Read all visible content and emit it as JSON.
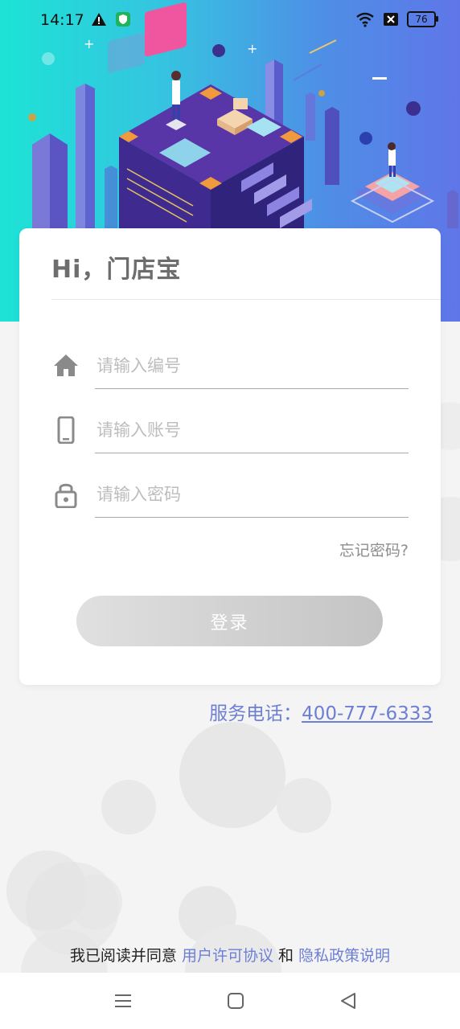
{
  "status": {
    "time": "14:17",
    "battery": "76",
    "icons": [
      "warning-icon",
      "shield-icon",
      "wifi-icon",
      "sim-off-icon",
      "battery-icon"
    ]
  },
  "login": {
    "title": "Hi，门店宝",
    "store_placeholder": "请输入编号",
    "account_placeholder": "请输入账号",
    "password_placeholder": "请输入密码",
    "forgot": "忘记密码?",
    "submit": "登录"
  },
  "service": {
    "label": "服务电话：",
    "phone": "400-777-6333"
  },
  "agreement": {
    "prefix": "我已阅读并同意",
    "user_agreement": "用户许可协议",
    "and": "和",
    "privacy": "隐私政策说明"
  },
  "colors": {
    "hero_start": "#1de3d5",
    "hero_end": "#5f76e8",
    "link": "#6d7fd4",
    "button_start": "#e0e0e0",
    "button_end": "#c4c4c4"
  },
  "navbar": {
    "icons": [
      "menu-icon",
      "home-square-icon",
      "back-triangle-icon"
    ]
  }
}
